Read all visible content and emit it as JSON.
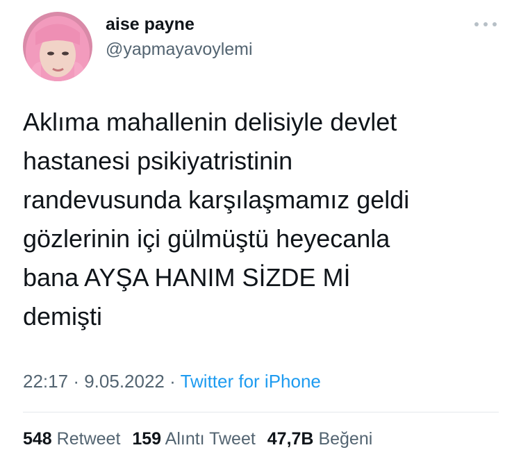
{
  "tweet": {
    "author": {
      "display_name": "aise payne",
      "handle": "@yapmayavoylemi"
    },
    "text_lines": [
      "Aklıma mahallenin delisiyle devlet",
      "hastanesi psikiyatristinin",
      "randevusunda karşılaşmamız geldi",
      "gözlerinin içi gülmüştü heyecanla",
      "bana AYŞA HANIM SİZDE Mİ",
      "demişti"
    ],
    "time": "22:17",
    "date": "9.05.2022",
    "separator": "·",
    "source": "Twitter for iPhone",
    "stats": {
      "retweets_count": "548",
      "retweets_label": "Retweet",
      "quotes_count": "159",
      "quotes_label": "Alıntı Tweet",
      "likes_count": "47,7B",
      "likes_label": "Beğeni"
    }
  },
  "icons": {
    "more": "more-horizontal-icon"
  },
  "colors": {
    "text": "#0f1419",
    "secondary": "#536471",
    "link": "#1d9bf0",
    "divider": "#e4e8eb",
    "avatar_hair": "#f29bbd"
  }
}
